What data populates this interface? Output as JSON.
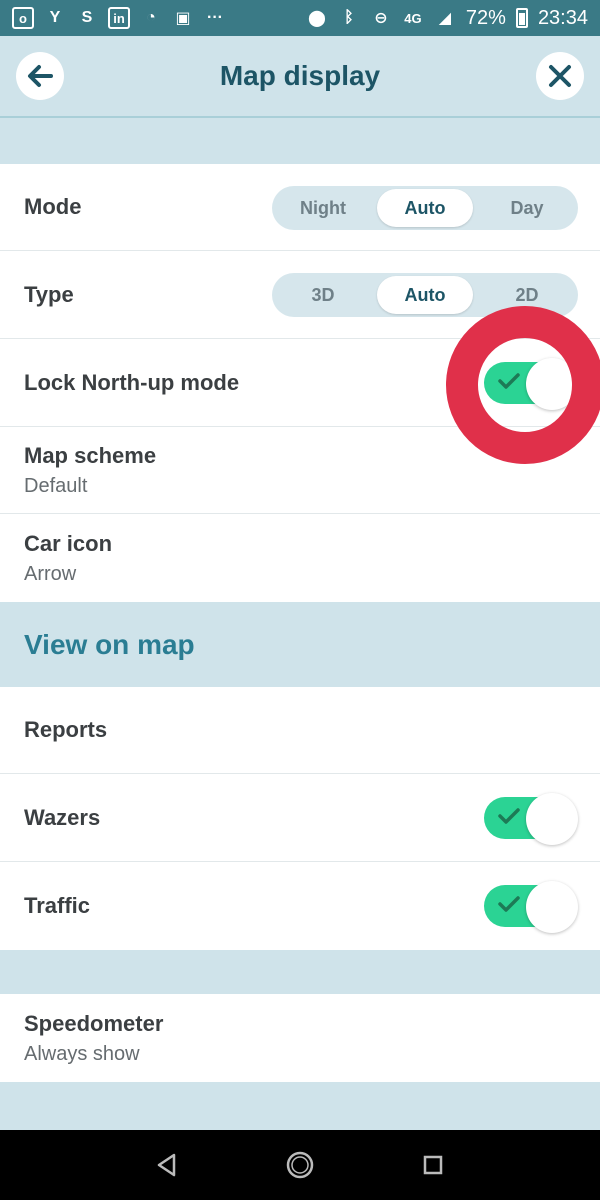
{
  "status_bar": {
    "network": "4G",
    "battery": "72%",
    "time": "23:34"
  },
  "header": {
    "title": "Map display"
  },
  "settings": {
    "mode": {
      "label": "Mode",
      "options": [
        "Night",
        "Auto",
        "Day"
      ],
      "selected": "Auto"
    },
    "type": {
      "label": "Type",
      "options": [
        "3D",
        "Auto",
        "2D"
      ],
      "selected": "Auto"
    },
    "lock_north": {
      "label": "Lock North-up mode",
      "enabled": true
    },
    "map_scheme": {
      "label": "Map scheme",
      "value": "Default"
    },
    "car_icon": {
      "label": "Car icon",
      "value": "Arrow"
    }
  },
  "view_on_map": {
    "title": "View on map",
    "reports": {
      "label": "Reports"
    },
    "wazers": {
      "label": "Wazers",
      "enabled": true
    },
    "traffic": {
      "label": "Traffic",
      "enabled": true
    }
  },
  "speedometer": {
    "label": "Speedometer",
    "value": "Always show"
  },
  "colors": {
    "toggle_on": "#2bd394",
    "accent": "#2a7d93",
    "title": "#1d5566",
    "highlight": "#e0304a"
  },
  "icons": {
    "back": "arrow-left-icon",
    "close": "close-icon",
    "nav_back": "triangle-back-icon",
    "nav_home": "circle-home-icon",
    "nav_recent": "square-recent-icon"
  }
}
